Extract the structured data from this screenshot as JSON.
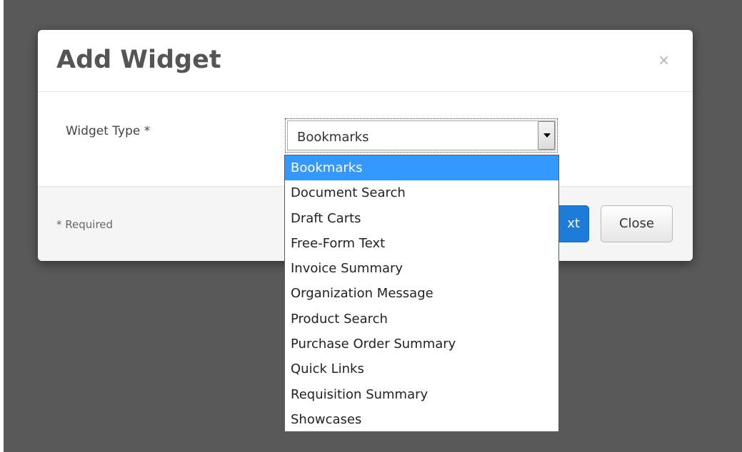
{
  "dialog": {
    "title": "Add Widget",
    "close_glyph": "×",
    "field_label": "Widget Type *",
    "select": {
      "value": "Bookmarks",
      "options": [
        "Bookmarks",
        "Document Search",
        "Draft Carts",
        "Free-Form Text",
        "Invoice Summary",
        "Organization Message",
        "Product Search",
        "Purchase Order Summary",
        "Quick Links",
        "Requisition Summary",
        "Showcases"
      ],
      "highlighted_index": 0
    },
    "footer": {
      "required_note": "* Required",
      "next_button_visible_text": "xt",
      "close_button": "Close"
    }
  },
  "colors": {
    "backdrop": "#595959",
    "highlight": "#3399ff",
    "primary_button": "#1e7cd8",
    "title": "#555555"
  }
}
